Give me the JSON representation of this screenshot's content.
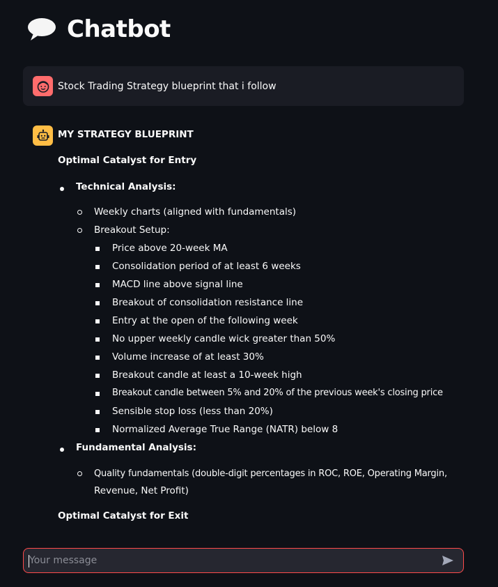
{
  "page": {
    "title": "Chatbot",
    "title_icon": "speech-balloon-icon"
  },
  "colors": {
    "background": "#0e1117",
    "user_message_bg": "#1a1c24",
    "user_avatar": "#ff6c6c",
    "bot_avatar": "#ffbd45",
    "input_border": "#ff4b4b",
    "input_bg": "#262730"
  },
  "messages": {
    "user": {
      "avatar_icon": "smiling-face-icon",
      "text": "Stock Trading Strategy blueprint that i follow"
    },
    "assistant": {
      "avatar_icon": "robot-icon",
      "heading": "MY STRATEGY BLUEPRINT",
      "section_entry": "Optimal Catalyst for Entry",
      "technical": {
        "label": "Technical Analysis:",
        "weekly": "Weekly charts (aligned with fundamentals)",
        "breakout_label": "Breakout Setup:",
        "criteria": [
          "Price above 20-week MA",
          "Consolidation period of at least 6 weeks",
          "MACD line above signal line",
          "Breakout of consolidation resistance line",
          "Entry at the open of the following week",
          "No upper weekly candle wick greater than 50%",
          "Volume increase of at least 30%",
          "Breakout candle at least a 10-week high",
          "Breakout candle between 5% and 20% of the previous week's closing price",
          "Sensible stop loss (less than 20%)",
          "Normalized Average True Range (NATR) below 8"
        ]
      },
      "fundamental": {
        "label": "Fundamental Analysis:",
        "quality_line1": "Quality fundamentals (double-digit percentages in ROC, ROE, Operating Margin,",
        "quality_line2": "Revenue, Net Profit)"
      },
      "section_exit": "Optimal Catalyst for Exit"
    }
  },
  "chat_input": {
    "placeholder": "Your message",
    "value": "",
    "send_icon": "send-icon"
  }
}
